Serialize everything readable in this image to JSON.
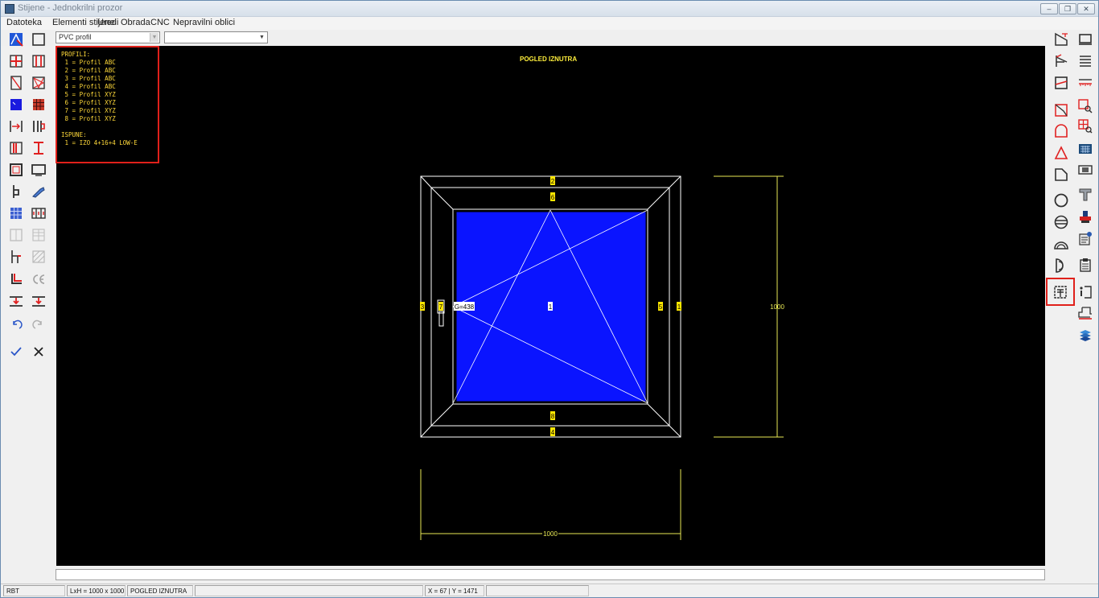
{
  "window": {
    "title": "Stijene - Jednokrilni prozor"
  },
  "menu": [
    "Datoteka",
    "Elementi stijene",
    "Uredi",
    "Obrada",
    "CNC",
    "Nepravilni oblici"
  ],
  "toolbar": {
    "profile_select_value": "PVC profil",
    "second_select_value": ""
  },
  "info_panel": {
    "lines": [
      "PROFILI:",
      " 1 = Profil ABC",
      " 2 = Profil ABC",
      " 3 = Profil ABC",
      " 4 = Profil ABC",
      " 5 = Profil XYZ",
      " 6 = Profil XYZ",
      " 7 = Profil XYZ",
      " 8 = Profil XYZ",
      "",
      "ISPUNE:",
      " 1 = IZO 4+16+4 LOW-E"
    ]
  },
  "canvas": {
    "view_title": "POGLED IZNUTRA",
    "profile_labels": [
      "2",
      "6",
      "3",
      "7",
      "5",
      "1",
      "8",
      "4"
    ],
    "glass_label": "1",
    "handle_label": "G=438",
    "height_dimension": "1000",
    "width_dimension": "1000",
    "glass_color": "#0a14ff",
    "line_color": "#ffffff",
    "dimension_color": "#e8e855"
  },
  "status": {
    "mode": "RBT",
    "size": "LxH = 1000 x 1000",
    "view": "POGLED IZNUTRA",
    "coords": "X = 67 | Y = 1471"
  }
}
